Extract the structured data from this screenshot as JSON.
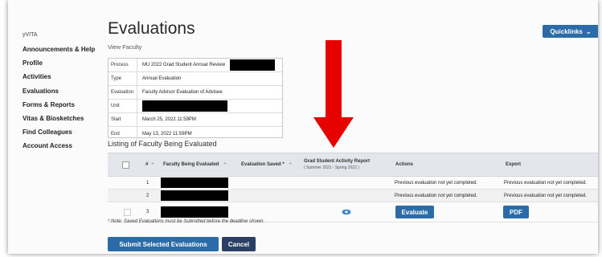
{
  "header": {
    "title": "Evaluations",
    "quicklinks_label": "Quicklinks",
    "breadcrumb": "View Faculty"
  },
  "sidebar": {
    "brand": "yVITA",
    "items": [
      {
        "label": "Announcements & Help"
      },
      {
        "label": "Profile"
      },
      {
        "label": "Activities"
      },
      {
        "label": "Evaluations"
      },
      {
        "label": "Forms & Reports"
      },
      {
        "label": "Vitas & Biosketches"
      },
      {
        "label": "Find Colleagues"
      },
      {
        "label": "Account Access"
      }
    ]
  },
  "process_info": {
    "process_label": "Process",
    "process_value": "MU 2022 Grad Student Annual Review",
    "type_label": "Type",
    "type_value": "Annual Evaluation",
    "evaluation_label": "Evaluation",
    "evaluation_value": "Faculty Advisor Evaluation of Advisee",
    "unit_label": "Unit",
    "start_label": "Start",
    "start_value": "March 25, 2022 11:59PM",
    "end_label": "End",
    "end_value": "May 13, 2022 11:59PM"
  },
  "listing": {
    "title": "Listing of Faculty Being Evaluated",
    "columns": {
      "number": "#",
      "faculty": "Faculty Being Evaluated",
      "saved": "Evaluation Saved *",
      "report": "Grad Student Activity Report",
      "report_sub": "( Summer 2021 - Spring 2022 )",
      "actions": "Actions",
      "export": "Export"
    },
    "rows": [
      {
        "number": "1",
        "actions": "Previous evaluation not yet completed.",
        "export": "Previous evaluation not yet completed."
      },
      {
        "number": "2",
        "actions": "Previous evaluation not yet completed.",
        "export": "Previous evaluation not yet completed."
      },
      {
        "number": "3",
        "evaluate_label": "Evaluate",
        "pdf_label": "PDF"
      }
    ]
  },
  "note": "* Note: Saved Evaluations must be Submitted before the deadline shown.",
  "footer": {
    "submit_label": "Submit Selected Evaluations",
    "cancel_label": "Cancel"
  },
  "colors": {
    "accent": "#2b6ca8",
    "cancel": "#2b3e64",
    "annotation_arrow": "#e60000"
  }
}
